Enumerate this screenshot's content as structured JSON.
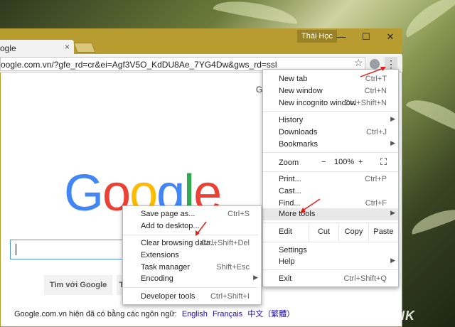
{
  "window": {
    "profile_name": "Thái Học",
    "minimize_glyph": "—",
    "maximize_glyph": "☐",
    "close_glyph": "✕"
  },
  "tab": {
    "title": "ogle",
    "close_glyph": "×"
  },
  "omnibox": {
    "url": "oogle.com.vn/?gfe_rd=cr&ei=Agf3V5O_KdDU8Ae_7YG4Dw&gws_rd=ssl"
  },
  "toolbar_icons": {
    "star": "bookmark-star-icon",
    "menu": "kebab-menu-icon",
    "extension": "extension-icon"
  },
  "page": {
    "top_right_text": "G",
    "logo": [
      "G",
      "o",
      "o",
      "g",
      "l",
      "e"
    ],
    "logo_colors": [
      "#4285F4",
      "#EA4335",
      "#FBBC05",
      "#4285F4",
      "#34A853",
      "#EA4335"
    ],
    "search_button": "Tìm với Google",
    "lucky_button": "T",
    "languages_prefix": "Google.com.vn hiện đã có bằng các ngôn ngữ:",
    "languages": [
      "English",
      "Français",
      "中文（繁體）"
    ]
  },
  "menu": {
    "new_tab": {
      "label": "New tab",
      "shortcut": "Ctrl+T"
    },
    "new_window": {
      "label": "New window",
      "shortcut": "Ctrl+N"
    },
    "incognito": {
      "label": "New incognito window",
      "shortcut": "Ctrl+Shift+N"
    },
    "history": {
      "label": "History",
      "arrow": "▶"
    },
    "downloads": {
      "label": "Downloads",
      "shortcut": "Ctrl+J"
    },
    "bookmarks": {
      "label": "Bookmarks",
      "arrow": "▶"
    },
    "zoom": {
      "label": "Zoom",
      "minus": "−",
      "value": "100%",
      "plus": "+",
      "fullscreen": "⛶"
    },
    "print": {
      "label": "Print...",
      "shortcut": "Ctrl+P"
    },
    "cast": {
      "label": "Cast..."
    },
    "find": {
      "label": "Find...",
      "shortcut": "Ctrl+F"
    },
    "more_tools": {
      "label": "More tools",
      "arrow": "▶"
    },
    "edit": {
      "label": "Edit",
      "cut": "Cut",
      "copy": "Copy",
      "paste": "Paste"
    },
    "settings": {
      "label": "Settings"
    },
    "help": {
      "label": "Help",
      "arrow": "▶"
    },
    "exit": {
      "label": "Exit",
      "shortcut": "Ctrl+Shift+Q"
    }
  },
  "submenu": {
    "save_page": {
      "label": "Save page as...",
      "shortcut": "Ctrl+S"
    },
    "add_desktop": {
      "label": "Add to desktop..."
    },
    "clear_data": {
      "label": "Clear browsing data...",
      "shortcut": "Ctrl+Shift+Del"
    },
    "extensions": {
      "label": "Extensions"
    },
    "task_manager": {
      "label": "Task manager",
      "shortcut": "Shift+Esc"
    },
    "encoding": {
      "label": "Encoding",
      "arrow": "▶"
    },
    "dev_tools": {
      "label": "Developer tools",
      "shortcut": "Ctrl+Shift+I"
    }
  },
  "annotation_color": "#e0201c",
  "watermark": "GENK"
}
